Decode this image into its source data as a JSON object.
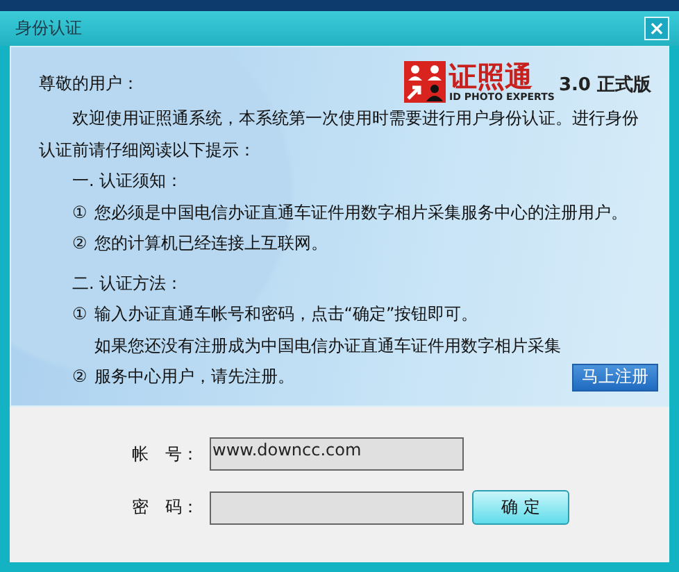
{
  "window": {
    "title": "身份认证",
    "close": "×"
  },
  "logo": {
    "name": "证照通",
    "tagline": "ID PHOTO EXPERTS",
    "version": "3.0 正式版"
  },
  "greeting": "尊敬的用户：",
  "intro": "欢迎使用证照通系统，本系统第一次使用时需要进行用户身份认证。进行身份认证前请仔细阅读以下提示：",
  "sections": [
    {
      "heading": "一. 认证须知：",
      "items": [
        {
          "marker": "①",
          "text": "您必须是中国电信办证直通车证件用数字相片采集服务中心的注册用户。"
        },
        {
          "marker": "②",
          "text": "您的计算机已经连接上互联网。"
        }
      ]
    },
    {
      "heading": "二. 认证方法：",
      "items": [
        {
          "marker": "①",
          "text": "输入办证直通车帐号和密码，点击“确定”按钮即可。"
        },
        {
          "marker": "②",
          "text": "如果您还没有注册成为中国电信办证直通车证件用数字相片采集服务中心用户，请先注册。",
          "button": "马上注册"
        }
      ]
    }
  ],
  "form": {
    "fields": [
      {
        "label": "帐　号：",
        "value": "www.downcc.com"
      },
      {
        "label": "密　码："
      }
    ],
    "confirm_button": "确 定"
  }
}
